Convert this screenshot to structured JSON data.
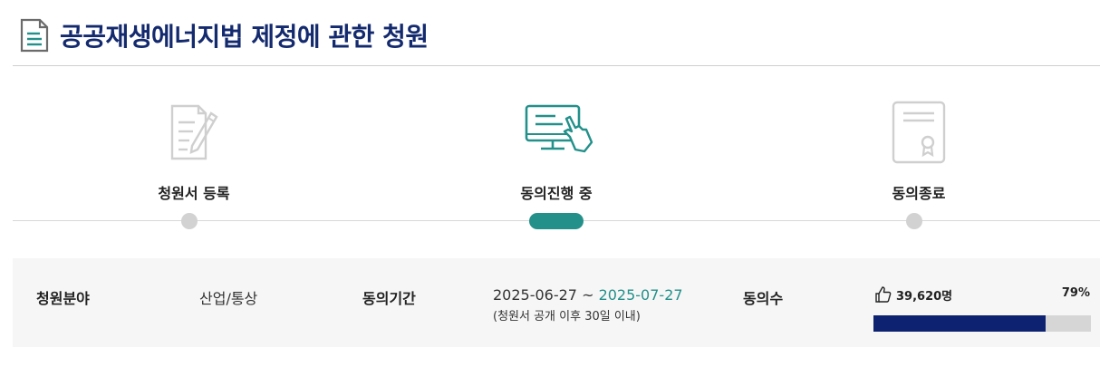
{
  "title": "공공재생에너지법 제정에 관한 청원",
  "steps": [
    {
      "label": "청원서 등록",
      "state": "done",
      "icon": "document-pen-icon"
    },
    {
      "label": "동의진행 중",
      "state": "active",
      "icon": "monitor-touch-icon"
    },
    {
      "label": "동의종료",
      "state": "pending",
      "icon": "certificate-icon"
    }
  ],
  "info": {
    "category_label": "청원분야",
    "category_value": "산업/통상",
    "period_label": "동의기간",
    "period_start": "2025-06-27",
    "period_sep": " ~ ",
    "period_end": "2025-07-27",
    "period_note": "(청원서 공개 이후 30일 이내)",
    "votes_label": "동의수",
    "votes_count": "39,620명",
    "votes_percent": "79%",
    "votes_progress": 0.79
  },
  "colors": {
    "title": "#142a6e",
    "accent": "#23908a",
    "progress": "#0d2270",
    "inactive": "#d2d2d2"
  }
}
